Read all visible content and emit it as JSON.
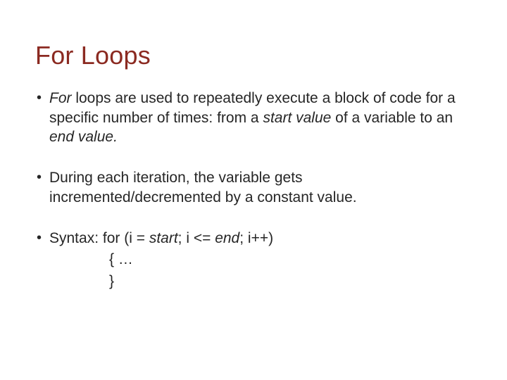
{
  "title": "For Loops",
  "bullets": {
    "b1": {
      "t1": "For",
      "t2": " loops are used to repeatedly execute a block of code for a specific number of times: from a ",
      "t3": "start value",
      "t4": " of a variable to an ",
      "t5": "end value.",
      "t6": ""
    },
    "b2": {
      "text": "During each iteration, the variable gets incremented/decremented by a constant value."
    },
    "b3": {
      "label": "Syntax:  ",
      "line1a": "for (i = ",
      "line1b": "start",
      "line1c": "; i <= ",
      "line1d": "end",
      "line1e": "; i++)",
      "line2": "{ …",
      "line3": "}"
    }
  }
}
